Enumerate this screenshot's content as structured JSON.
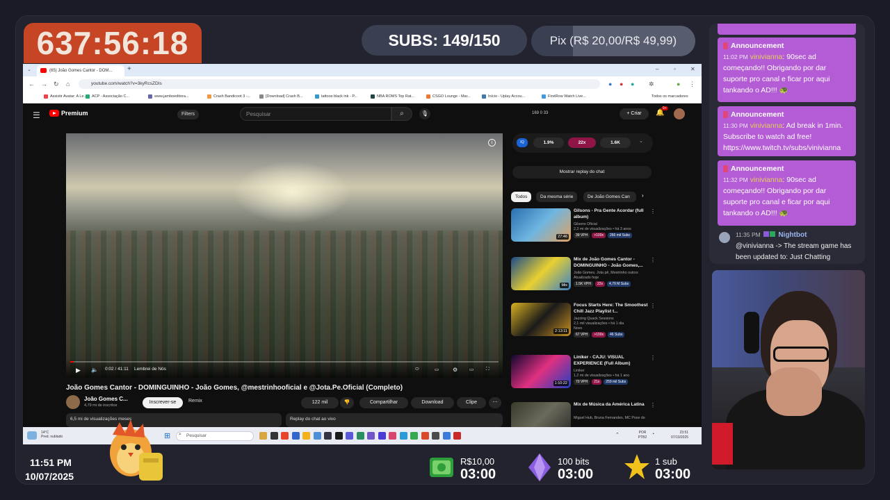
{
  "overlay": {
    "timer": "637:56:18",
    "subs_label": "SUBS: 149/150",
    "pix_label": "Pix (R$ 20,00/R$ 49,99)",
    "clock_time": "11:51 PM",
    "clock_date": "10/07/2025",
    "goals": [
      {
        "label": "R$10,00",
        "time": "03:00",
        "icon": "cash-icon"
      },
      {
        "label": "100 bits",
        "time": "03:00",
        "icon": "bits-gem-icon"
      },
      {
        "label": "1 sub",
        "time": "03:00",
        "icon": "star-icon"
      }
    ]
  },
  "browser": {
    "tab_title": "(65) João Gomes Cantor - DOM...",
    "url": "youtube.com/watch?v=3kyRcsZDIs",
    "bookmarks": [
      "Assistir Avatar: A Le...",
      "ACP - Associação C...",
      "www.jamboeditora...",
      "Crash Bandicoot 3 -...",
      "[Download] Crash B...",
      "tattoos black ink - P...",
      "NBA ROMS Top Rat...",
      "CSGO Lounge - Mar...",
      "Início - Uplay Accou...",
      "FirstRow Watch Live..."
    ],
    "bookmarks_all": "Todos os marcadores"
  },
  "youtube": {
    "logo": "Premium",
    "filters": "Filters",
    "search_placeholder": "Pesquisar",
    "stats": "169   0   33",
    "create": "+ Criar",
    "notif_count": "9+",
    "player": {
      "time": "0:02 / 41:11",
      "chapter": "Lembrei de Nós"
    },
    "title": "João Gomes Cantor - DOMINGUINHO - João Gomes, @mestrinhooficial e @Jota.Pe.Oficial (Completo)",
    "channel": "João Gomes C...",
    "subscribers": "4,79 mi de inscritos",
    "subscribe": "Inscrever-se",
    "remix": "Remix",
    "likes": "122 mil",
    "share": "Compartilhar",
    "download": "Download",
    "clip": "Clipe",
    "views": "6,5 mi de visualizações  meses",
    "chat_replay_bar": "Replay do chat ao vivo",
    "iq": {
      "left": "1.9%",
      "mid": "22x",
      "right": "1.6K"
    },
    "replay_button": "Mostrar replay do chat",
    "chips": [
      "Todos",
      "Da mesma série",
      "De João Gomes Can"
    ],
    "recommended": [
      {
        "title": "Gilsons - Pra Gente Acordar (full album)",
        "channel": "Gilsons Oficial",
        "meta": "2,3 mi de visualizações • há 3 anos",
        "duration": "27:46",
        "tags": [
          "39 VPH",
          ">100x",
          "266 mil Subs"
        ]
      },
      {
        "title": "Mix de João Gomes Cantor - DOMINGUINHO - João Gomes,...",
        "channel": "João Gomes, Jota pê, Mestrinho outros",
        "meta": "Atualizado hoje",
        "duration": "Mix",
        "tags": [
          "1.5K VPH",
          "22x",
          "4,79 M Subs"
        ]
      },
      {
        "title": "Focus Starts Here: The Smoothest Chill Jazz Playlist t...",
        "channel": "Jazzing Quack Sessions",
        "meta": "2,1 mil visualizações • há 1 dia",
        "extra": "Novo",
        "duration": "2:13:11",
        "tags": [
          "67 VPH",
          ">100x",
          "46 Subs"
        ]
      },
      {
        "title": "Liniker - CAJU: VISUAL EXPERIENCE (Full Album)",
        "channel": "Liniker",
        "meta": "1,2 mi de visualizações • há 1 ano",
        "duration": "1:10:22",
        "tags": [
          "70 VPH",
          "21x",
          "259 mil Subs"
        ]
      },
      {
        "title": "Mix de Música da América Latina",
        "channel": "Miguel Hub, Bruna Fernandes, MC Pose do",
        "meta": "",
        "duration": "",
        "tags": []
      }
    ]
  },
  "taskbar": {
    "weather": "14°C",
    "weather_sub": "Pred. nublado",
    "search": "Pesquisar",
    "lang": "POR PTB2",
    "time": "23:51",
    "date": "07/10/2025"
  },
  "chat": {
    "messages": [
      {
        "type": "Announcement",
        "time": "11:02 PM",
        "user": "vinivianna",
        "text": ": 90sec ad começando!! Obrigando por dar suporte pro canal e ficar por aqui tankando o AD!!! 🐢"
      },
      {
        "type": "Announcement",
        "time": "11:30 PM",
        "user": "vinivianna",
        "text": ": Ad break in 1min. Subscribe to watch ad free! https://www.twitch.tv/subs/vinivianna"
      },
      {
        "type": "Announcement",
        "time": "11:32 PM",
        "user": "vinivianna",
        "text": ": 90sec ad começando!! Obrigando por dar suporte pro canal e ficar por aqui tankando o AD!!! 🐢"
      }
    ],
    "bot": {
      "time": "11:35 PM",
      "user": "Nightbot",
      "text": "@vinivianna -> The stream game has been updated to: Just Chatting"
    }
  },
  "colors": {
    "timer_bg": "#c64525",
    "announcement": "#b45cd6",
    "yt_red": "#ff0000"
  }
}
